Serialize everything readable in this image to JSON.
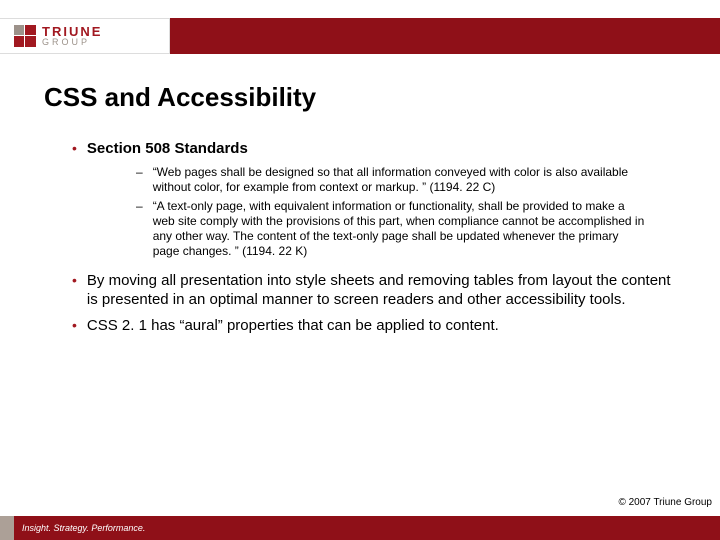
{
  "logo": {
    "line1": "TRIUNE",
    "line2": "GROUP"
  },
  "title": "CSS and Accessibility",
  "bullets": [
    {
      "label": "Section 508 Standards",
      "bold": true,
      "sub": [
        "“Web pages shall be designed so that all information conveyed with color is also available without color, for example from context or markup. ” (1194. 22 C)",
        "“A text-only page, with equivalent information or functionality, shall be provided to make a web site comply with the provisions of this part, when compliance cannot be accomplished in any other way. The content of the text-only page shall be updated whenever the primary page changes. ” (1194. 22 K)"
      ]
    },
    {
      "label": "By moving all presentation into style sheets and removing tables from layout the content is presented in an optimal manner to screen readers and other accessibility tools.",
      "bold": false,
      "sub": []
    },
    {
      "label": "CSS 2. 1 has “aural” properties that can be applied to content.",
      "bold": false,
      "sub": []
    }
  ],
  "copyright": "© 2007 Triune Group",
  "footer": "Insight. Strategy. Performance."
}
